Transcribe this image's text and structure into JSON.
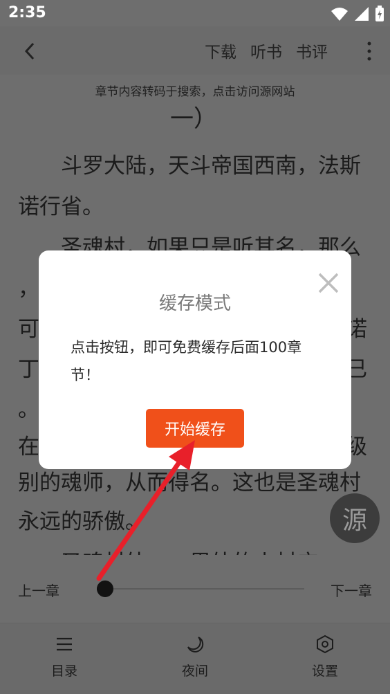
{
  "status": {
    "time": "2:35",
    "wifi_icon": "wifi-icon",
    "signal_icon": "signal-icon",
    "battery_icon": "battery-charging-icon"
  },
  "topbar": {
    "back_icon": "back-chevron-icon",
    "actions": [
      {
        "label": "下载"
      },
      {
        "label": "听书"
      },
      {
        "label": "书评"
      }
    ],
    "more_icon": "more-vertical-icon"
  },
  "reader": {
    "source_note": "章节内容转码于搜索，点击访问源网站",
    "chapter_fragment": "一）",
    "lines": [
      "　　斗罗大陆，天斗帝国西南，法斯",
      "诺行省。",
      "　　圣魂村，如果只是听其名，那么",
      "，",
      "可",
      "丁",
      "。",
      "在",
      "别的魂师，从而得名。这也是圣魂村",
      "永远的骄傲。",
      "　　圣魂村外，一里外的小村庄"
    ],
    "right_fragments": [
      "",
      "",
      "诺",
      "",
      "已",
      "",
      "级"
    ],
    "source_fab_label": "源"
  },
  "progress": {
    "prev_label": "上一章",
    "next_label": "下一章",
    "value": 0.04
  },
  "bottomnav": [
    {
      "label": "目录",
      "icon": "menu-list-icon"
    },
    {
      "label": "夜间",
      "icon": "moon-icon"
    },
    {
      "label": "设置",
      "icon": "settings-hex-icon"
    }
  ],
  "dialog": {
    "title": "缓存模式",
    "message": "点击按钮，即可免费缓存后面100章节！",
    "button_label": "开始缓存",
    "close_icon": "close-x-icon"
  },
  "colors": {
    "accent": "#f0501a",
    "overlay": "#6e6e6e",
    "arrow": "#e8202a"
  }
}
